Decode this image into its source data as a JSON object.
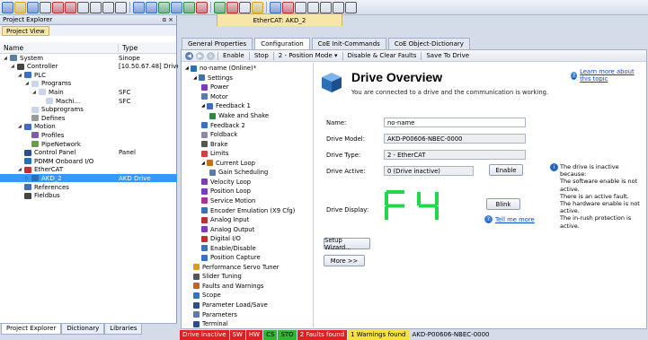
{
  "toolbar": {
    "icons": [
      "new-project-icon",
      "open-icon",
      "save-icon",
      "print-icon",
      "undo-icon",
      "redo-icon",
      "cut-icon",
      "copy-icon",
      "paste-icon",
      "find-icon",
      "build-icon",
      "network-icon",
      "check-icon",
      "download-icon",
      "login-icon",
      "logout-icon",
      "run-icon",
      "stop-icon",
      "reset-icon",
      "toggle-icon",
      "watch-icon",
      "breakpoint-icon",
      "pause-icon",
      "step-icon",
      "step-over-icon",
      "step-into-icon",
      "step-out-icon"
    ]
  },
  "doc_tab": "EtherCAT: AKD_2",
  "project_explorer": {
    "title": "Project Explorer",
    "pin": "ɑ ×",
    "view_tab": "Project View",
    "col_name": "Name",
    "col_type": "Type",
    "rows": [
      {
        "label": "System",
        "type": "Sinope",
        "indent": 0,
        "toggle": "◢",
        "icon": "#5a7bb0"
      },
      {
        "label": "Controller",
        "type": "[10.50.67.48] Drive",
        "indent": 1,
        "toggle": "◢",
        "icon": "#444"
      },
      {
        "label": "PLC",
        "type": "",
        "indent": 2,
        "toggle": "◢",
        "icon": "#3b6fbf"
      },
      {
        "label": "Programs",
        "type": "",
        "indent": 3,
        "toggle": "◢",
        "icon": "#c9d6ea"
      },
      {
        "label": "Main",
        "type": "SFC",
        "indent": 4,
        "toggle": "◢",
        "icon": "#c9d6ea"
      },
      {
        "label": "Machi...",
        "type": "SFC",
        "indent": 5,
        "toggle": "",
        "icon": "#c9d6ea"
      },
      {
        "label": "Subprograms",
        "type": "",
        "indent": 3,
        "toggle": "",
        "icon": "#c9d6ea"
      },
      {
        "label": "Defines",
        "type": "",
        "indent": 3,
        "toggle": "",
        "icon": "#999"
      },
      {
        "label": "Motion",
        "type": "",
        "indent": 2,
        "toggle": "◢",
        "icon": "#3b6fbf"
      },
      {
        "label": "Profiles",
        "type": "",
        "indent": 3,
        "toggle": "",
        "icon": "#7d5cb0"
      },
      {
        "label": "PipeNetwork",
        "type": "",
        "indent": 3,
        "toggle": "",
        "icon": "#6a9a4a"
      },
      {
        "label": "Control Panel",
        "type": "Panel",
        "indent": 2,
        "toggle": "",
        "icon": "#2a4f8a"
      },
      {
        "label": "PDMM Onboard I/O",
        "type": "",
        "indent": 2,
        "toggle": "",
        "icon": "#2a6fb0"
      },
      {
        "label": "EtherCAT",
        "type": "",
        "indent": 2,
        "toggle": "◢",
        "icon": "#c03030"
      },
      {
        "label": "AKD_2",
        "type": "AKD Drive",
        "indent": 3,
        "toggle": "▷",
        "icon": "#2a6fb0",
        "selected": true
      },
      {
        "label": "References",
        "type": "",
        "indent": 2,
        "toggle": "",
        "icon": "#3b6fbf"
      },
      {
        "label": "Fieldbus",
        "type": "",
        "indent": 2,
        "toggle": "",
        "icon": "#444"
      }
    ],
    "bottom_tabs": [
      "Project Explorer",
      "Dictionary",
      "Libraries"
    ]
  },
  "main_tabs": [
    "General Properties",
    "Configuration",
    "CoE Init-Commands",
    "CoE Object-Dictionary"
  ],
  "commands": [
    "Enable",
    "Stop",
    "2 - Position Mode ▾",
    "Disable & Clear Faults",
    "Save To Drive"
  ],
  "drive_tree": [
    {
      "label": "no-name (Online)*",
      "indent": 0,
      "icon": "#2a6fb0",
      "toggle": "◢"
    },
    {
      "label": "Settings",
      "indent": 1,
      "icon": "#3b6fbf",
      "toggle": "◢"
    },
    {
      "label": "Power",
      "indent": 2,
      "icon": "#7a3bbf",
      "toggle": ""
    },
    {
      "label": "Motor",
      "indent": 2,
      "icon": "#5a7bb0",
      "toggle": ""
    },
    {
      "label": "Feedback 1",
      "indent": 2,
      "icon": "#3b6fbf",
      "toggle": "◢"
    },
    {
      "label": "Wake and Shake",
      "indent": 3,
      "icon": "#2e8a3e",
      "toggle": ""
    },
    {
      "label": "Feedback 2",
      "indent": 2,
      "icon": "#3b6fbf",
      "toggle": ""
    },
    {
      "label": "Foldback",
      "indent": 2,
      "icon": "#8a8aa8",
      "toggle": ""
    },
    {
      "label": "Brake",
      "indent": 2,
      "icon": "#555",
      "toggle": ""
    },
    {
      "label": "Limits",
      "indent": 2,
      "icon": "#d04040",
      "toggle": ""
    },
    {
      "label": "Current Loop",
      "indent": 2,
      "icon": "#c07020",
      "toggle": "◢"
    },
    {
      "label": "Gain Scheduling",
      "indent": 3,
      "icon": "#5a7bb0",
      "toggle": ""
    },
    {
      "label": "Velocity Loop",
      "indent": 2,
      "icon": "#7a3bbf",
      "toggle": ""
    },
    {
      "label": "Position Loop",
      "indent": 2,
      "icon": "#7a3bbf",
      "toggle": ""
    },
    {
      "label": "Service Motion",
      "indent": 2,
      "icon": "#b03090",
      "toggle": ""
    },
    {
      "label": "Encoder Emulation (X9 Cfg)",
      "indent": 2,
      "icon": "#3b6fbf",
      "toggle": ""
    },
    {
      "label": "Analog Input",
      "indent": 2,
      "icon": "#c03030",
      "toggle": ""
    },
    {
      "label": "Analog Output",
      "indent": 2,
      "icon": "#7a3bbf",
      "toggle": ""
    },
    {
      "label": "Digital I/O",
      "indent": 2,
      "icon": "#c03030",
      "toggle": ""
    },
    {
      "label": "Enable/Disable",
      "indent": 2,
      "icon": "#3b6fbf",
      "toggle": ""
    },
    {
      "label": "Position Capture",
      "indent": 2,
      "icon": "#3b6fbf",
      "toggle": ""
    },
    {
      "label": "Performance Servo Tuner",
      "indent": 1,
      "icon": "#d0a020",
      "toggle": ""
    },
    {
      "label": "Slider Tuning",
      "indent": 1,
      "icon": "#555",
      "toggle": ""
    },
    {
      "label": "Faults and Warnings",
      "indent": 1,
      "icon": "#d06020",
      "toggle": ""
    },
    {
      "label": "Scope",
      "indent": 1,
      "icon": "#3b6fbf",
      "toggle": ""
    },
    {
      "label": "Parameter Load/Save",
      "indent": 1,
      "icon": "#2a4f8a",
      "toggle": ""
    },
    {
      "label": "Parameters",
      "indent": 1,
      "icon": "#5a7bb0",
      "toggle": ""
    },
    {
      "label": "Terminal",
      "indent": 1,
      "icon": "#2a4f8a",
      "toggle": ""
    }
  ],
  "overview": {
    "title": "Drive Overview",
    "subtitle": "You are connected to a drive and the communication is working.",
    "learn": "Learn more about this topic",
    "name_label": "Name:",
    "name_value": "no-name",
    "model_label": "Drive Model:",
    "model_value": "AKD-P00606-NBEC-0000",
    "type_label": "Drive Type:",
    "type_value": "2 - EtherCAT",
    "active_label": "Drive Active:",
    "active_value": "0 (Drive inactive)",
    "enable_btn": "Enable",
    "display_label": "Drive Display:",
    "display_value": "F4",
    "blink_btn": "Blink",
    "tell_me": "Tell me more",
    "setup_btn": "Setup Wizard...",
    "more_btn": "More >>",
    "inactive_reasons": [
      "The drive is inactive because:",
      "The software enable is not active.",
      "There is an active fault.",
      "The hardware enable is not active.",
      "The in-rush protection is active."
    ]
  },
  "status_bar": [
    {
      "text": "Drive inactive",
      "bg": "#e02020",
      "fg": "#fff"
    },
    {
      "text": "SW",
      "bg": "#e02020",
      "fg": "#fff"
    },
    {
      "text": "HW",
      "bg": "#e02020",
      "fg": "#fff"
    },
    {
      "text": "CS",
      "bg": "#2eb82e",
      "fg": "#000"
    },
    {
      "text": "STO",
      "bg": "#2eb82e",
      "fg": "#000"
    },
    {
      "text": "2 Faults found",
      "bg": "#e02020",
      "fg": "#fff"
    },
    {
      "text": "1 Warnings found",
      "bg": "#f5e23a",
      "fg": "#000"
    },
    {
      "text": "AKD-P00606-NBEC-0000",
      "bg": "transparent",
      "fg": "#000"
    }
  ]
}
